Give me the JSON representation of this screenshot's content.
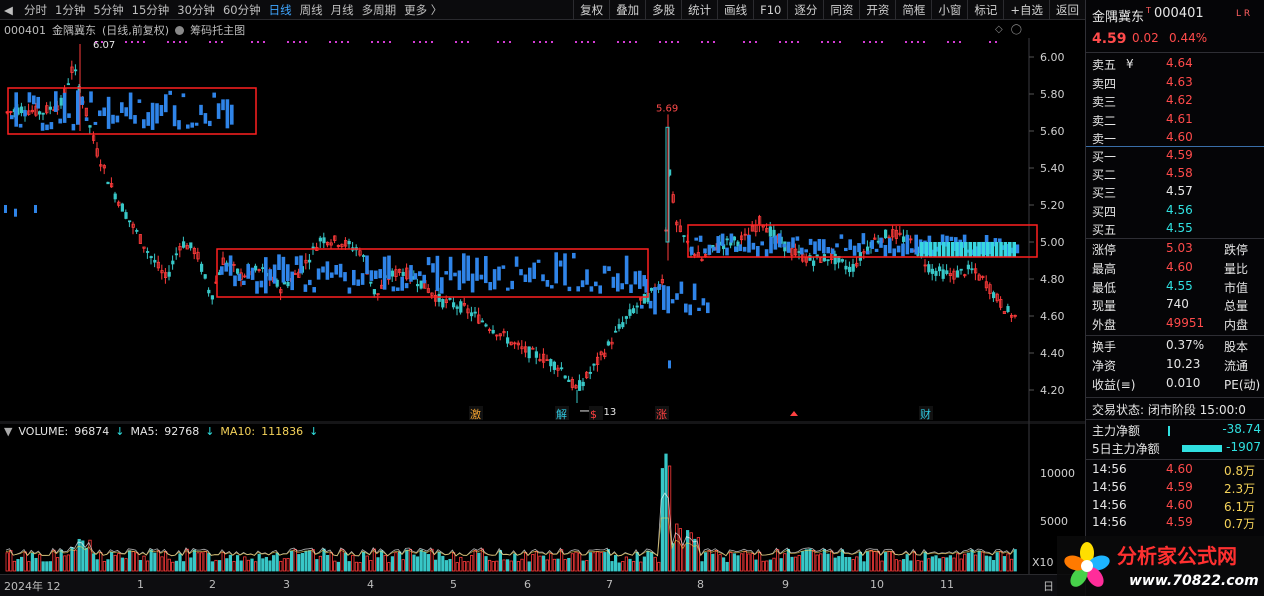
{
  "toolbar": {
    "periods": [
      "分时",
      "1分钟",
      "5分钟",
      "15分钟",
      "30分钟",
      "60分钟",
      "日线",
      "周线",
      "月线",
      "多周期",
      "更多 〉"
    ],
    "active_period": "日线",
    "buttons": [
      "复权",
      "叠加",
      "多股",
      "统计",
      "画线",
      "F10",
      "逐分",
      "同资",
      "开资",
      "简框",
      "小窗",
      "标记",
      "+自选",
      "返回"
    ]
  },
  "chart": {
    "header_code": "000401",
    "header_name": "金隅冀东",
    "header_mode": "(日线,前复权)",
    "header_extra": "筹码托主图",
    "price_axis": [
      "6.00",
      "5.80",
      "5.60",
      "5.40",
      "5.20",
      "5.00",
      "4.80",
      "4.60",
      "4.40",
      "4.20"
    ],
    "annotations": {
      "high_left": "6.07",
      "high_mid": "5.69",
      "low": "4.13"
    },
    "event_markers": [
      "激",
      "解",
      "$",
      "涨",
      "财"
    ],
    "colors": {
      "up": "#ff3b3b",
      "down": "#38c7c7",
      "chip": "#2f84e8",
      "box": "#ff2020",
      "ma5": "#ffffff",
      "ma10": "#f5d35a"
    }
  },
  "volume": {
    "legend": {
      "volume_label": "VOLUME:",
      "volume_value": "96874",
      "ma5_label": "MA5:",
      "ma5_value": "92768",
      "ma10_label": "MA10:",
      "ma10_value": "111836"
    },
    "axis": [
      "10000",
      "5000"
    ],
    "unit": "X10"
  },
  "time_axis": [
    "2024年 12",
    "1",
    "2",
    "3",
    "4",
    "5",
    "6",
    "7",
    "8",
    "9",
    "10",
    "11",
    "日"
  ],
  "panel": {
    "name": "金隅冀东",
    "code": "000401",
    "tags": "L R",
    "price": "4.59",
    "change": "0.02",
    "pct": "0.44%",
    "asks": [
      {
        "label": "卖五",
        "price": "4.64"
      },
      {
        "label": "卖四",
        "price": "4.63"
      },
      {
        "label": "卖三",
        "price": "4.62"
      },
      {
        "label": "卖二",
        "price": "4.61"
      },
      {
        "label": "卖一",
        "price": "4.60"
      }
    ],
    "bids": [
      {
        "label": "买一",
        "price": "4.59"
      },
      {
        "label": "买二",
        "price": "4.58"
      },
      {
        "label": "买三",
        "price": "4.57"
      },
      {
        "label": "买四",
        "price": "4.56"
      },
      {
        "label": "买五",
        "price": "4.55"
      }
    ],
    "stats": [
      {
        "k1": "涨停",
        "v1": "5.03",
        "k2": "跌停"
      },
      {
        "k1": "最高",
        "v1": "4.60",
        "k2": "量比"
      },
      {
        "k1": "最低",
        "v1": "4.55",
        "k2": "市值"
      },
      {
        "k1": "现量",
        "v1": "740",
        "k2": "总量"
      },
      {
        "k1": "外盘",
        "v1": "49951",
        "k2": "内盘"
      }
    ],
    "stats2": [
      {
        "k1": "换手",
        "v1": "0.37%",
        "k2": "股本"
      },
      {
        "k1": "净资",
        "v1": "10.23",
        "k2": "流通"
      },
      {
        "k1": "收益(≡)",
        "v1": "0.010",
        "k2": "PE(动)"
      }
    ],
    "trade_status": "交易状态: 闭市阶段 15:00:0",
    "main_flow": {
      "label": "主力净额",
      "value": "-38.74"
    },
    "main_flow_5d": {
      "label": "5日主力净额",
      "value": "-1907"
    },
    "ticks": [
      {
        "time": "14:56",
        "price": "4.60",
        "vol": "0.8万"
      },
      {
        "time": "14:56",
        "price": "4.59",
        "vol": "2.3万"
      },
      {
        "time": "14:56",
        "price": "4.60",
        "vol": "6.1万"
      },
      {
        "time": "14:56",
        "price": "4.59",
        "vol": "0.7万"
      }
    ]
  },
  "watermark": {
    "brand": "分析家公式网",
    "url": "www.70822.com"
  }
}
